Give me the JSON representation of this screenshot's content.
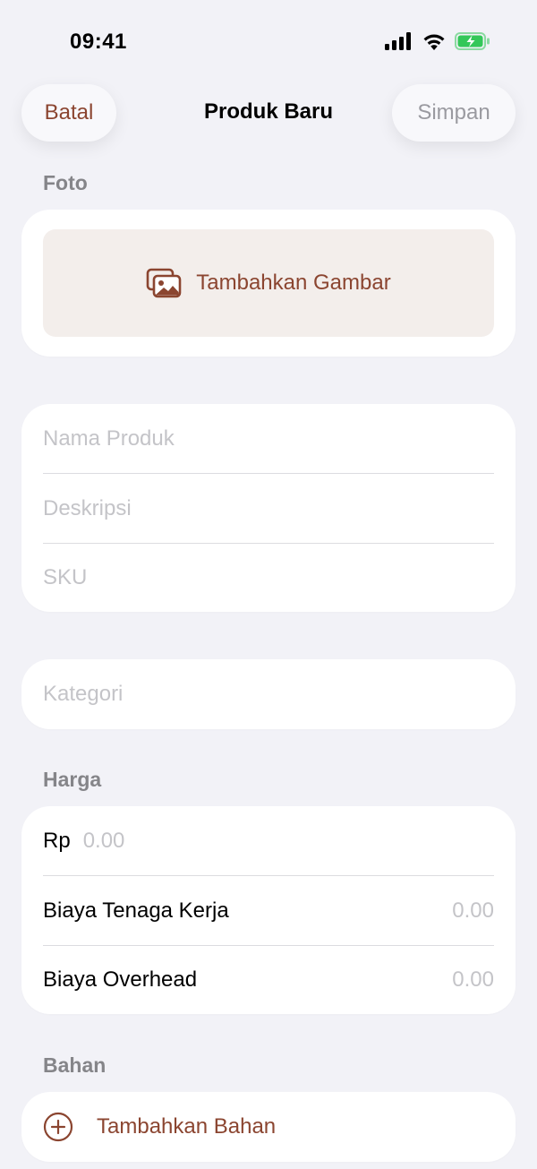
{
  "status_bar": {
    "time": "09:41",
    "icons": [
      "signal-icon",
      "wifi-icon",
      "battery-charging-icon"
    ],
    "battery_color": "#34c759"
  },
  "nav": {
    "cancel_label": "Batal",
    "title": "Produk Baru",
    "save_label": "Simpan"
  },
  "photo": {
    "section_label": "Foto",
    "add_label": "Tambahkan Gambar",
    "icon": "photo-gallery-icon"
  },
  "info": {
    "name_placeholder": "Nama Produk",
    "description_placeholder": "Deskripsi",
    "sku_placeholder": "SKU"
  },
  "category": {
    "placeholder": "Kategori"
  },
  "price": {
    "section_label": "Harga",
    "currency": "Rp",
    "price_placeholder": "0.00",
    "labor_label": "Biaya Tenaga Kerja",
    "labor_placeholder": "0.00",
    "overhead_label": "Biaya Overhead",
    "overhead_placeholder": "0.00"
  },
  "materials": {
    "section_label": "Bahan",
    "add_label": "Tambahkan Bahan",
    "icon": "plus-circle-icon"
  },
  "colors": {
    "accent": "#8b4530",
    "background": "#f2f2f7",
    "placeholder": "#c4c4c8"
  }
}
